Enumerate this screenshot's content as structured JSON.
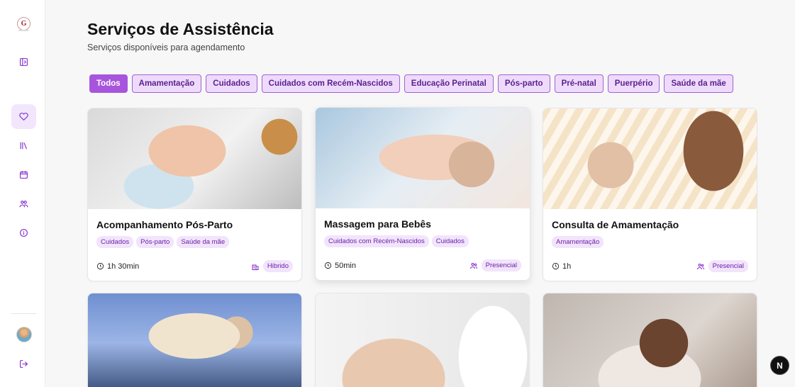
{
  "sidebar": {
    "logo_letter": "G",
    "icons": [
      "panel-toggle-icon",
      "heart-icon",
      "library-icon",
      "calendar-icon",
      "users-icon",
      "info-icon",
      "logout-icon"
    ]
  },
  "header": {
    "title": "Serviços de Assistência",
    "subtitle": "Serviços disponíveis para agendamento"
  },
  "filters": [
    "Todos",
    "Amamentação",
    "Cuidados",
    "Cuidados com Recém-Nascidos",
    "Educação Perinatal",
    "Pós-parto",
    "Pré-natal",
    "Puerpério",
    "Saúde da mãe"
  ],
  "active_filter": "Todos",
  "cards": [
    {
      "title": "Acompanhamento Pós-Parto",
      "tags": [
        "Cuidados",
        "Pós-parto",
        "Saúde da mãe"
      ],
      "duration": "1h 30min",
      "mode": "Hibrido",
      "mode_icon": "building-icon"
    },
    {
      "title": "Massagem para Bebês",
      "tags": [
        "Cuidados com Recém-Nascidos",
        "Cuidados"
      ],
      "duration": "50min",
      "mode": "Presencial",
      "mode_icon": "users-icon"
    },
    {
      "title": "Consulta de Amamentação",
      "tags": [
        "Amamentação"
      ],
      "duration": "1h",
      "mode": "Presencial",
      "mode_icon": "users-icon"
    }
  ],
  "next_badge": "N",
  "colors": {
    "accent": "#a855dd",
    "accent_light": "#eedbfb",
    "text_accent": "#6b21a8"
  }
}
